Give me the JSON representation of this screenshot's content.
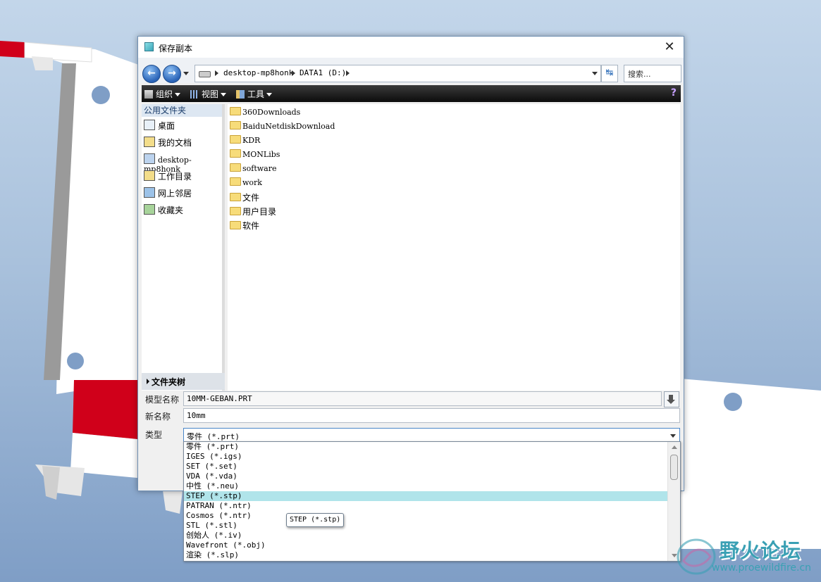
{
  "dialog": {
    "title": "保存副本",
    "nav": {
      "back_icon": "back-arrow-icon",
      "forward_icon": "forward-arrow-icon",
      "breadcrumbs": [
        "desktop-mp8honk",
        "DATA1 (D:)"
      ],
      "search_placeholder": "搜索..."
    },
    "toolbar": {
      "organize": "组织",
      "views": "视图",
      "tools": "工具"
    },
    "sidebar": {
      "header": "公用文件夹",
      "items": [
        {
          "label": "桌面",
          "icon": "desktop-icon"
        },
        {
          "label": "我的文档",
          "icon": "documents-icon"
        },
        {
          "label": "desktop-mp8honk",
          "icon": "computer-icon"
        },
        {
          "label": "工作目录",
          "icon": "working-dir-icon"
        },
        {
          "label": "网上邻居",
          "icon": "network-icon"
        },
        {
          "label": "收藏夹",
          "icon": "favorites-icon"
        }
      ],
      "folder_tree": "文件夹树"
    },
    "files": [
      "360Downloads",
      "BaiduNetdiskDownload",
      "KDR",
      "MONLibs",
      "software",
      "work",
      "文件",
      "用户目录",
      "软件"
    ],
    "form": {
      "model_name_label": "模型名称",
      "model_name_value": "10MM-GEBAN.PRT",
      "new_name_label": "新名称",
      "new_name_value": "10mm",
      "type_label": "类型",
      "type_value": "零件 (*.prt)"
    },
    "type_options": [
      "零件 (*.prt)",
      "IGES (*.igs)",
      "SET (*.set)",
      "VDA (*.vda)",
      "中性 (*.neu)",
      "STEP (*.stp)",
      "PATRAN (*.ntr)",
      "Cosmos (*.ntr)",
      "STL (*.stl)",
      "创始人 (*.iv)",
      "Wavefront (*.obj)",
      "渲染 (*.slp)"
    ],
    "selected_option_index": 5,
    "tooltip": "STEP (*.stp)"
  },
  "watermark": {
    "title": "野火论坛",
    "url": "www.proewildfire.cn"
  }
}
